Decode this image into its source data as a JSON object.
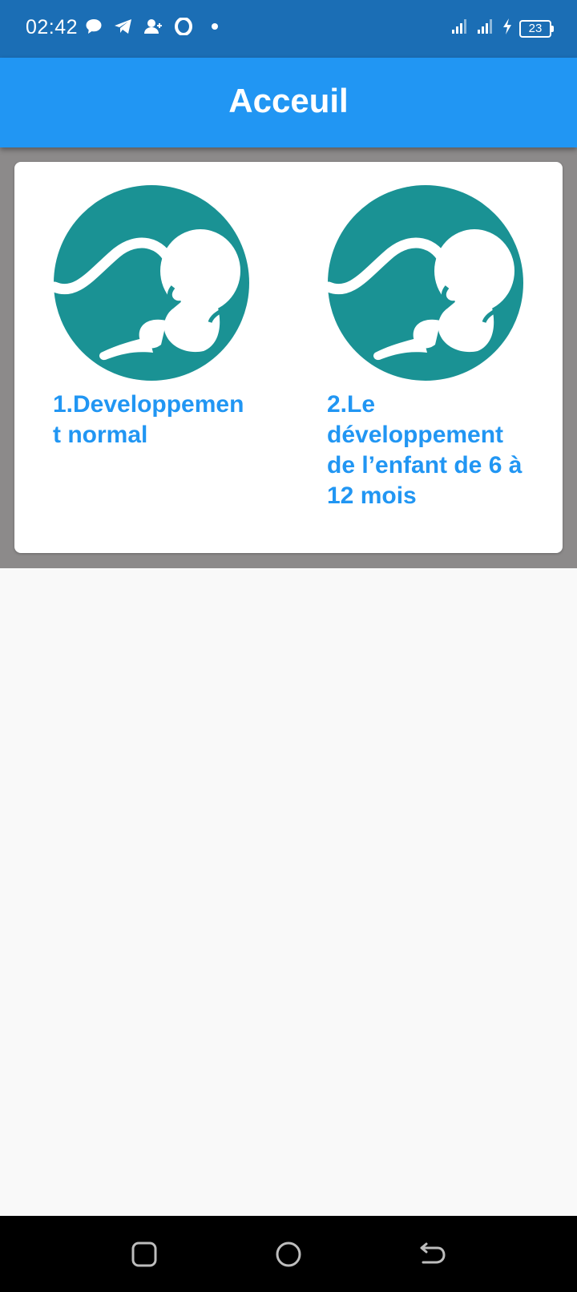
{
  "status_bar": {
    "time": "02:42",
    "left_icons": [
      "chat-bubble-icon",
      "telegram-icon",
      "add-contact-icon",
      "opera-icon",
      "dot-icon"
    ],
    "right_icons": [
      "signal-icon",
      "signal-icon",
      "charging-icon"
    ],
    "battery": "23"
  },
  "app_bar": {
    "title": "Acceuil",
    "color": "#2196f3"
  },
  "grid": {
    "items": [
      {
        "label": "1.Developpement normal",
        "icon": "fetus-icon"
      },
      {
        "label": "2.Le développement de l’enfant de 6 à 12 mois",
        "icon": "fetus-icon"
      }
    ],
    "thumb_color": "#1a9294",
    "label_color": "#2196f3"
  },
  "nav_bar": {
    "buttons": [
      "recents-button",
      "home-button",
      "back-button"
    ]
  }
}
